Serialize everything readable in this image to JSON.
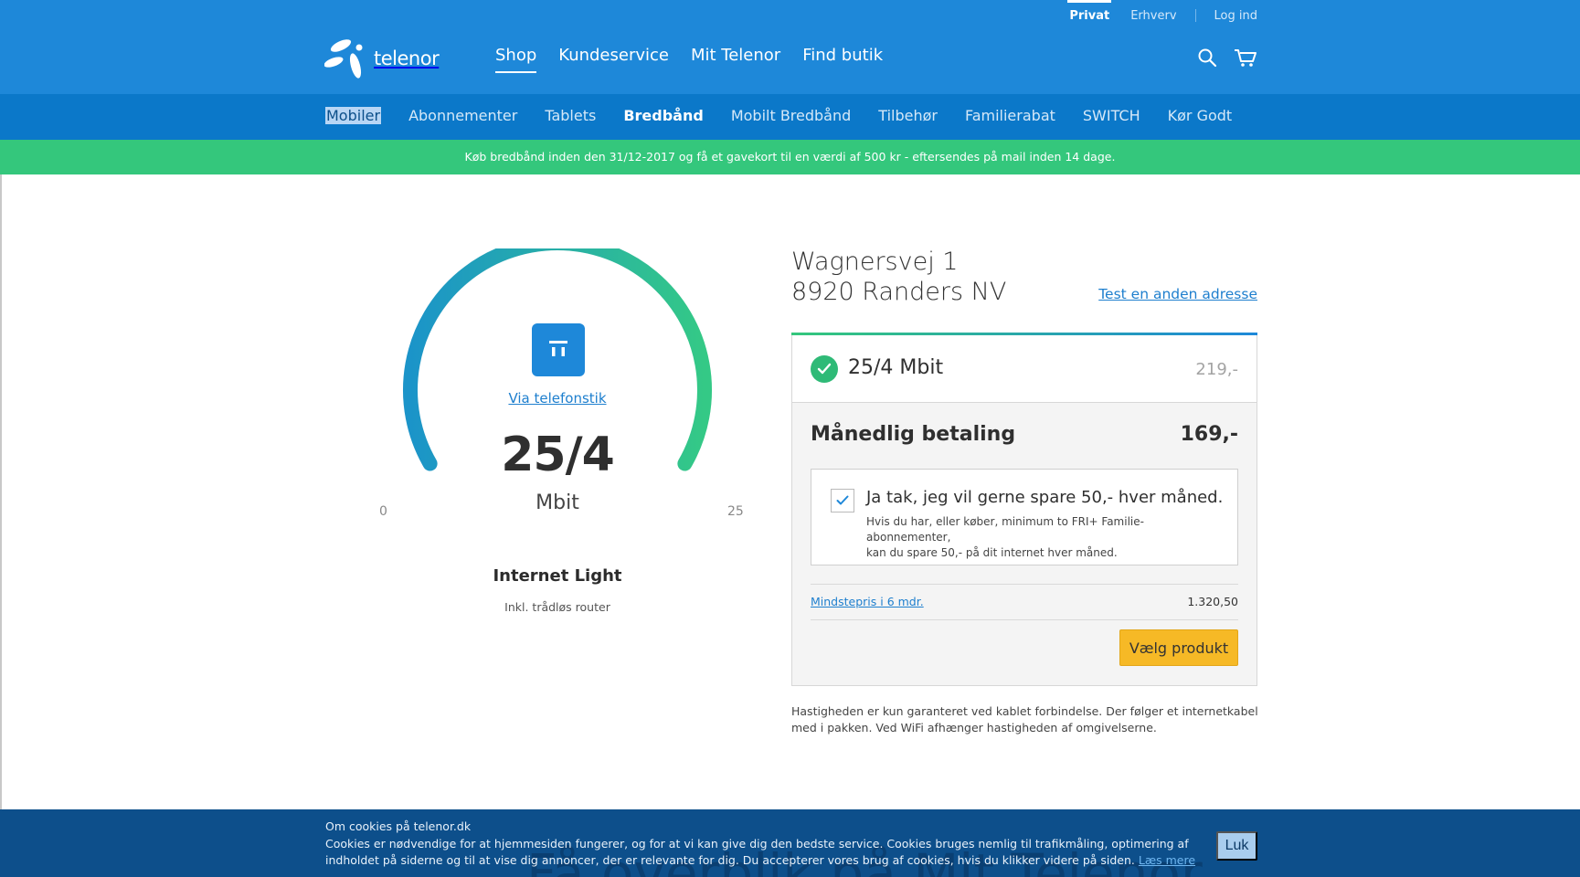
{
  "util_nav": {
    "privat": "Privat",
    "erhverv": "Erhverv",
    "login": "Log ind"
  },
  "brand": {
    "name": "telenor"
  },
  "main_nav": [
    "Shop",
    "Kundeservice",
    "Mit Telenor",
    "Find butik"
  ],
  "sub_nav": [
    "Mobiler",
    "Abonnementer",
    "Tablets",
    "Bredbånd",
    "Mobilt Bredbånd",
    "Tilbehør",
    "Familierabat",
    "SWITCH",
    "Kør Godt"
  ],
  "promo": "Køb bredbånd inden den 31/12-2017 og få et gavekort til en værdi af 500 kr - eftersendes på mail inden 14 dage.",
  "gauge": {
    "via_label": "Via telefonstik",
    "speed": "25/4",
    "unit": "Mbit",
    "min_label": "0",
    "max_label": "25",
    "level": 1.0
  },
  "package": {
    "name": "Internet Light",
    "sub": "Inkl. trådløs router"
  },
  "address": {
    "street": "Wagnersvej 1",
    "city": "8920 Randers NV",
    "other_link": "Test en anden adresse"
  },
  "offer": {
    "title": "25/4 Mbit",
    "old_price": "219,-",
    "monthly_label": "Månedlig betaling",
    "monthly_price": "169,-",
    "save_label": "Ja tak, jeg vil gerne spare 50,- hver måned.",
    "save_line1": "Hvis du har, eller køber, minimum to FRI+ Familie-abonnementer,",
    "save_line2": "kan du spare 50,- på dit internet hver måned.",
    "save_checked": true,
    "min_label": "Mindstepris i 6 mdr.",
    "min_value": "1.320,50",
    "choose_button": "Vælg produkt"
  },
  "disclaimer": "Hastigheden er kun garanteret ved kablet forbindelse. Der følger et internetkabel med i pakken. Ved WiFi afhænger hastigheden af omgivelserne.",
  "cookie": {
    "title": "Om cookies på telenor.dk",
    "text": "Cookies er nødvendige for at hjemmesiden fungerer, og for at vi kan give dig den bedste service. Cookies bruges nemlig til trafikmåling, optimering af indholdet på siderne og til at vise dig annoncer, der er relevante for dig. Du accepterer vores brug af cookies, hvis du klikker videre på siden.",
    "read_more": "Læs mere",
    "close": "Luk",
    "behind_text": "Få overblik på Mit Telenor"
  },
  "colors": {
    "brand_blue": "#1e88d9",
    "subnav_blue": "#0b78c9",
    "promo_green": "#34c77c",
    "cta_yellow": "#f6b926",
    "cookie_bg": "#0d4f8b"
  }
}
